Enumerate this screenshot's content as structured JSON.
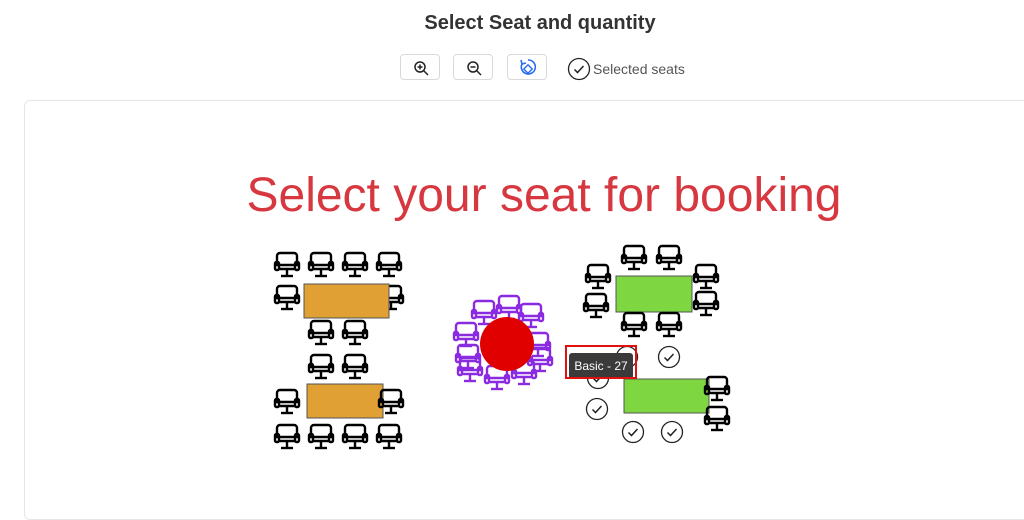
{
  "header": {
    "title": "Select Seat and quantity"
  },
  "toolbar": {
    "zoom_in": "zoom-in-icon",
    "zoom_out": "zoom-out-icon",
    "reset": "reset-view-icon",
    "selected_legend": "Selected seats"
  },
  "stage": {
    "heading": "Select your seat for booking",
    "tooltip": "Basic - 27",
    "colors": {
      "table_orange": "#e0a034",
      "table_green": "#7ed640",
      "round_table": "#e00000",
      "seat_default": "#000000",
      "seat_round": "#8a2be2",
      "heading": "#d7373f"
    }
  }
}
